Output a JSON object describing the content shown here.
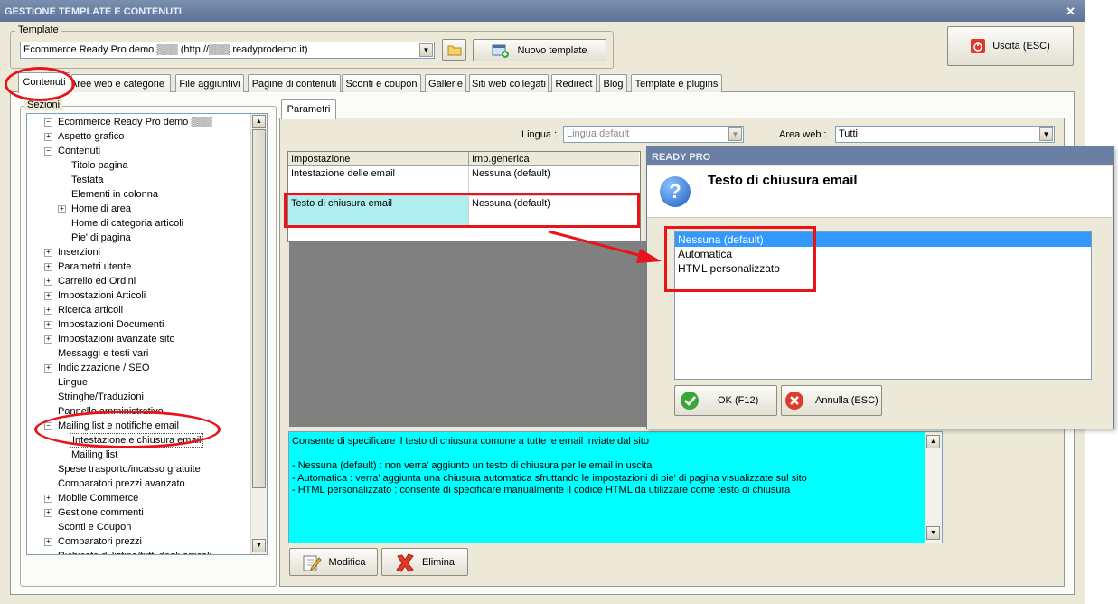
{
  "window": {
    "title": "GESTIONE TEMPLATE E CONTENUTI",
    "close_glyph": "✕"
  },
  "template_group": {
    "label": "Template",
    "selected": "Ecommerce Ready Pro demo ▒▒▒ (http://▒▒▒.readyprodemo.it)",
    "new_button": "Nuovo template"
  },
  "exit_button": "Uscita (ESC)",
  "tabs": [
    "Contenuti",
    "Aree web e categorie",
    "File aggiuntivi",
    "Pagine di contenuti",
    "Sconti e coupon",
    "Gallerie",
    "Siti web collegati",
    "Redirect",
    "Blog",
    "Template e plugins"
  ],
  "sections": {
    "label": "Sezioni",
    "tree": [
      {
        "label": "Ecommerce Ready Pro demo ▒▒▒",
        "exp": "−"
      },
      {
        "label": "Aspetto grafico",
        "exp": "+"
      },
      {
        "label": "Contenuti",
        "exp": "−"
      },
      {
        "label": "Titolo pagina",
        "exp": ""
      },
      {
        "label": "Testata",
        "exp": ""
      },
      {
        "label": "Elementi in colonna",
        "exp": ""
      },
      {
        "label": "Home di area",
        "exp": "+"
      },
      {
        "label": "Home di categoria articoli",
        "exp": ""
      },
      {
        "label": "Pie' di pagina",
        "exp": ""
      },
      {
        "label": "Inserzioni",
        "exp": "+"
      },
      {
        "label": "Parametri utente",
        "exp": "+"
      },
      {
        "label": "Carrello ed Ordini",
        "exp": "+"
      },
      {
        "label": "Impostazioni Articoli",
        "exp": "+"
      },
      {
        "label": "Ricerca articoli",
        "exp": "+"
      },
      {
        "label": "Impostazioni Documenti",
        "exp": "+"
      },
      {
        "label": "Impostazioni avanzate sito",
        "exp": "+"
      },
      {
        "label": "Messaggi e testi vari",
        "exp": ""
      },
      {
        "label": "Indicizzazione / SEO",
        "exp": "+"
      },
      {
        "label": "Lingue",
        "exp": ""
      },
      {
        "label": "Stringhe/Traduzioni",
        "exp": ""
      },
      {
        "label": "Pannello amministrativo",
        "exp": ""
      },
      {
        "label": "Mailing list e notifiche email",
        "exp": "−"
      },
      {
        "label": "Intestazione e chiusura email",
        "exp": ""
      },
      {
        "label": "Mailing list",
        "exp": ""
      },
      {
        "label": "Spese trasporto/incasso gratuite",
        "exp": ""
      },
      {
        "label": "Comparatori prezzi avanzato",
        "exp": ""
      },
      {
        "label": "Mobile Commerce",
        "exp": "+"
      },
      {
        "label": "Gestione commenti",
        "exp": "+"
      },
      {
        "label": "Sconti e Coupon",
        "exp": ""
      },
      {
        "label": "Comparatori prezzi",
        "exp": "+"
      },
      {
        "label": "Richieste di listino/tutti degli articoli",
        "exp": ""
      }
    ]
  },
  "params": {
    "tab": "Parametri",
    "lingua_label": "Lingua :",
    "lingua_value": "Lingua default",
    "area_label": "Area web :",
    "area_value": "Tutti",
    "columns": [
      "Impostazione",
      "Imp.generica"
    ],
    "rows": [
      {
        "setting": "Intestazione delle email",
        "value": "Nessuna (default)"
      },
      {
        "setting": "Testo di chiusura email",
        "value": "Nessuna (default)"
      }
    ]
  },
  "help_text": [
    "Consente di specificare il testo di chiusura comune a tutte le email inviate dal sito",
    "",
    "- Nessuna (default) : non verra' aggiunto un testo di chiusura per le email in uscita",
    "- Automatica : verra' aggiunta una chiusura automatica sfruttando le impostazioni di pie' di pagina visualizzate sul sito",
    "- HTML personalizzato : consente di specificare manualmente il codice HTML da utilizzare come testo di chiusura"
  ],
  "buttons": {
    "modifica": "Modifica",
    "elimina": "Elimina"
  },
  "dialog": {
    "title": "READY PRO",
    "question_glyph": "?",
    "heading": "Testo di chiusura email",
    "options": [
      "Nessuna (default)",
      "Automatica",
      "HTML personalizzato"
    ],
    "selected_index": 0,
    "ok": "OK (F12)",
    "cancel": "Annulla (ESC)"
  },
  "colors": {
    "help_bg": "#00ffff",
    "highlight_row": "#aeeeee",
    "selection": "#3399ff",
    "annotation": "#e8141a"
  }
}
